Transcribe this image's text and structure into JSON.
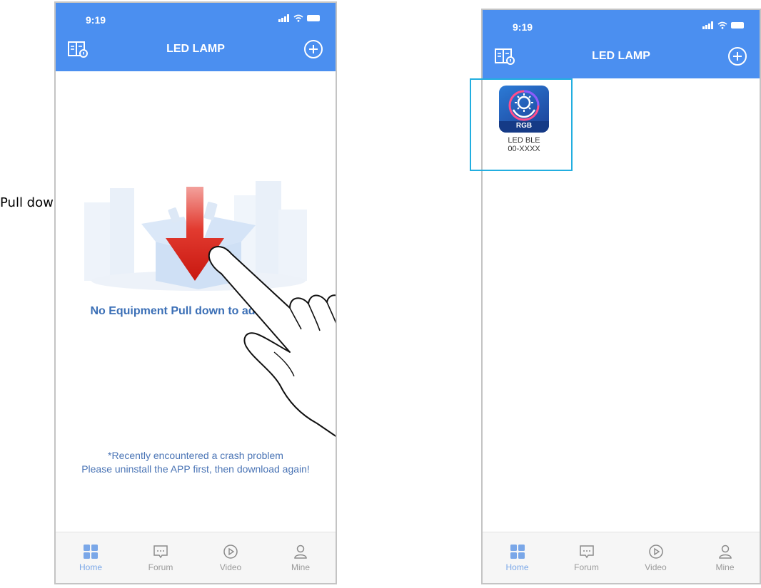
{
  "status_bar": {
    "time": "9:19"
  },
  "header": {
    "title": "LED LAMP"
  },
  "left_screen": {
    "empty_message": "No Equipment  Pull down to add device",
    "crash_notice_line1": "*Recently encountered a crash problem",
    "crash_notice_line2": "Please uninstall the APP first, then download again!"
  },
  "annotation": {
    "text": "Pull down refresh"
  },
  "device": {
    "icon_badge": "RGB",
    "name": "LED BLE",
    "id": "00-XXXX"
  },
  "tabs": [
    {
      "label": "Home",
      "icon": "home-grid-icon"
    },
    {
      "label": "Forum",
      "icon": "forum-chat-icon"
    },
    {
      "label": "Video",
      "icon": "video-play-icon"
    },
    {
      "label": "Mine",
      "icon": "person-icon"
    }
  ],
  "colors": {
    "header": "#4b8ff0",
    "accent_text": "#3b6fb6",
    "highlight_border": "#22aee0",
    "gesture_arrow": "#e02020"
  }
}
